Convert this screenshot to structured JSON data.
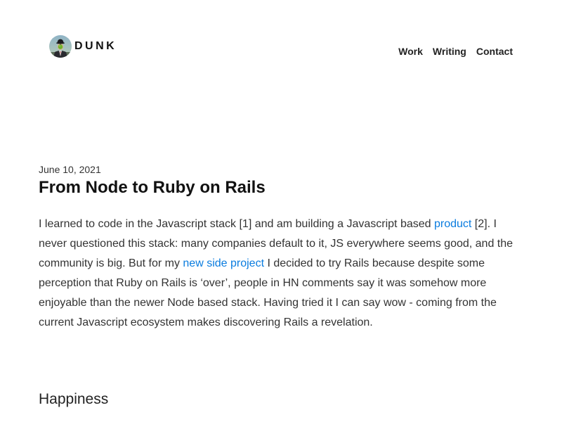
{
  "header": {
    "brand_name": "DUNK",
    "avatar_icon": "man-in-bowler-hat-avatar-icon",
    "nav": [
      {
        "label": "Work"
      },
      {
        "label": "Writing"
      },
      {
        "label": "Contact"
      }
    ]
  },
  "post": {
    "date": "June 10, 2021",
    "title": "From Node to Ruby on Rails",
    "body": {
      "text_1": "I learned to code in the Javascript stack [1] and am building a Javascript based ",
      "link_1": "product",
      "text_2": " [2]. I never questioned this stack: many companies default to it, JS everywhere seems good, and the community is big. But for my ",
      "link_2": "new side project",
      "text_3": " I decided to try Rails because despite some perception that Ruby on Rails is ‘over’, people in HN comments say it was somehow more enjoyable than the newer Node based stack. Having tried it I can say wow - coming from the current Javascript ecosystem makes discovering Rails a revelation."
    },
    "section_heading": "Happiness"
  },
  "colors": {
    "link": "#0a7cdf",
    "text": "#333333",
    "heading": "#111111",
    "background": "#ffffff"
  }
}
